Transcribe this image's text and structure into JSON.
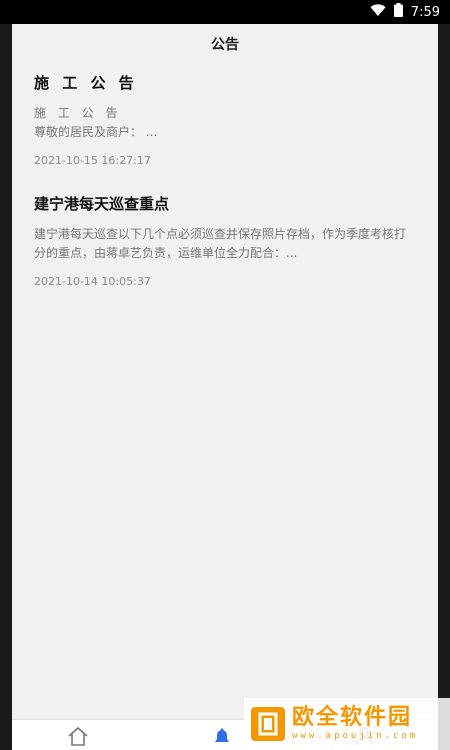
{
  "status_bar": {
    "time": "7:59",
    "wifi_icon": "wifi-icon",
    "battery_icon": "battery-icon"
  },
  "header": {
    "title": "公告"
  },
  "announcements": [
    {
      "title": "施 工 公 告",
      "subtitle": "施 工 公 告",
      "preview": "尊敬的居民及商户：  ...",
      "time": "2021-10-15 16:27:17"
    },
    {
      "title": "建宁港每天巡查重点",
      "preview": "建宁港每天巡查以下几个点必须巡查并保存照片存档，作为季度考核打分的重点，由蒋卓艺负责，运维单位全力配合：...",
      "time": "2021-10-14 10:05:37"
    }
  ],
  "bottom_nav": {
    "items": [
      "home-icon",
      "bell-icon",
      "user-icon"
    ]
  },
  "watermark": {
    "text": "欧全软件园",
    "url": "www.apoujin.com",
    "brand_color": "#f39800"
  }
}
